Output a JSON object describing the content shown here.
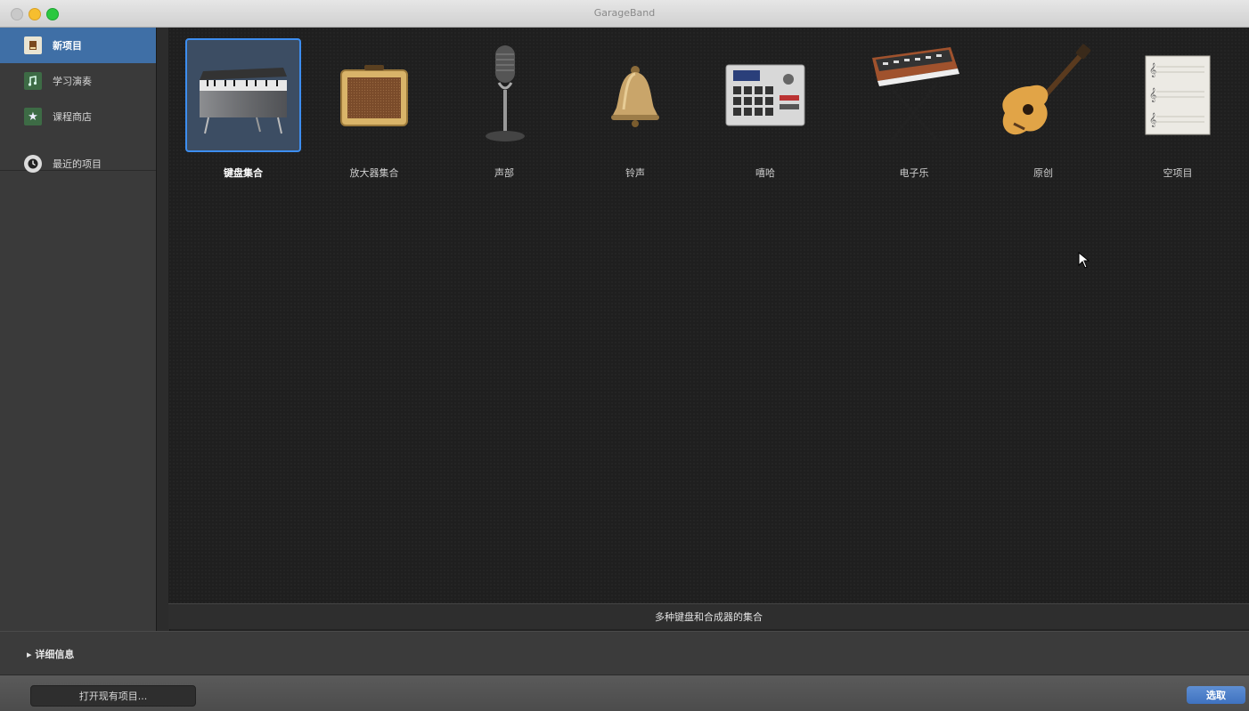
{
  "window": {
    "title": "GarageBand"
  },
  "sidebar": {
    "items": [
      {
        "label": "新项目",
        "icon": "new-project-icon",
        "selected": true
      },
      {
        "label": "学习演奏",
        "icon": "learn-to-play-icon",
        "selected": false
      },
      {
        "label": "课程商店",
        "icon": "lesson-store-icon",
        "selected": false
      },
      {
        "label": "最近的项目",
        "icon": "recent-projects-icon",
        "selected": false
      }
    ]
  },
  "templates": [
    {
      "label": "键盘集合",
      "icon": "electric-piano-icon",
      "selected": true
    },
    {
      "label": "放大器集合",
      "icon": "guitar-amp-icon",
      "selected": false
    },
    {
      "label": "声部",
      "icon": "microphone-icon",
      "selected": false
    },
    {
      "label": "铃声",
      "icon": "bell-icon",
      "selected": false
    },
    {
      "label": "嘻哈",
      "icon": "drum-machine-icon",
      "selected": false
    },
    {
      "label": "电子乐",
      "icon": "synthesizer-icon",
      "selected": false
    },
    {
      "label": "原创",
      "icon": "acoustic-guitar-icon",
      "selected": false
    },
    {
      "label": "空项目",
      "icon": "empty-project-icon",
      "selected": false
    }
  ],
  "description": "多种键盘和合成器的集合",
  "details": {
    "toggle_label": "▸ 详细信息"
  },
  "footer": {
    "open_button": "打开现有项目...",
    "choose_button": "选取"
  },
  "colors": {
    "selection": "#3f6fa6",
    "tile_border": "#3d8ef0",
    "primary_button": "#4a7cc8"
  }
}
